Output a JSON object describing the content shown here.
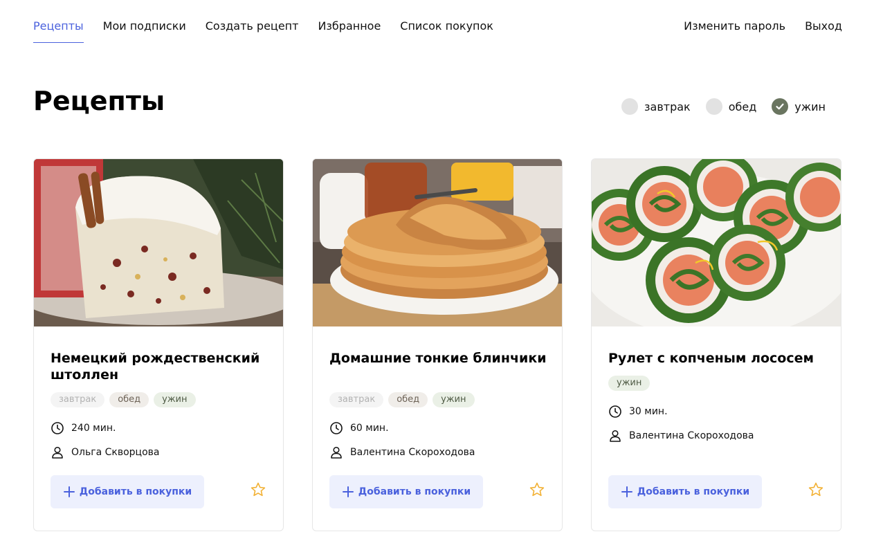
{
  "nav": {
    "items": [
      "Рецепты",
      "Мои подписки",
      "Создать рецепт",
      "Избранное",
      "Список покупок"
    ],
    "right": [
      "Изменить пароль",
      "Выход"
    ]
  },
  "page": {
    "title": "Рецепты"
  },
  "filters": [
    {
      "label": "завтрак",
      "checked": false
    },
    {
      "label": "обед",
      "checked": false
    },
    {
      "label": "ужин",
      "checked": true
    }
  ],
  "cards": [
    {
      "title": "Немецкий рождественский штоллен",
      "tags": [
        "завтрак",
        "обед",
        "ужин"
      ],
      "time": "240 мин.",
      "author": "Ольга Скворцова",
      "button": "Добавить в покупки"
    },
    {
      "title": "Домашние тонкие блинчики",
      "tags": [
        "завтрак",
        "обед",
        "ужин"
      ],
      "time": "60 мин.",
      "author": "Валентина Скороходова",
      "button": "Добавить в покупки"
    },
    {
      "title": "Рулет с копченым лососем",
      "tags": [
        "ужин"
      ],
      "time": "30 мин.",
      "author": "Валентина Скороходова",
      "button": "Добавить в покупки"
    }
  ],
  "colors": {
    "accent": "#4a61dd",
    "checked": "#6a7560",
    "star": "#f2b134"
  },
  "icons": [
    "check-icon",
    "clock-icon",
    "user-icon",
    "plus-icon",
    "star-icon"
  ]
}
